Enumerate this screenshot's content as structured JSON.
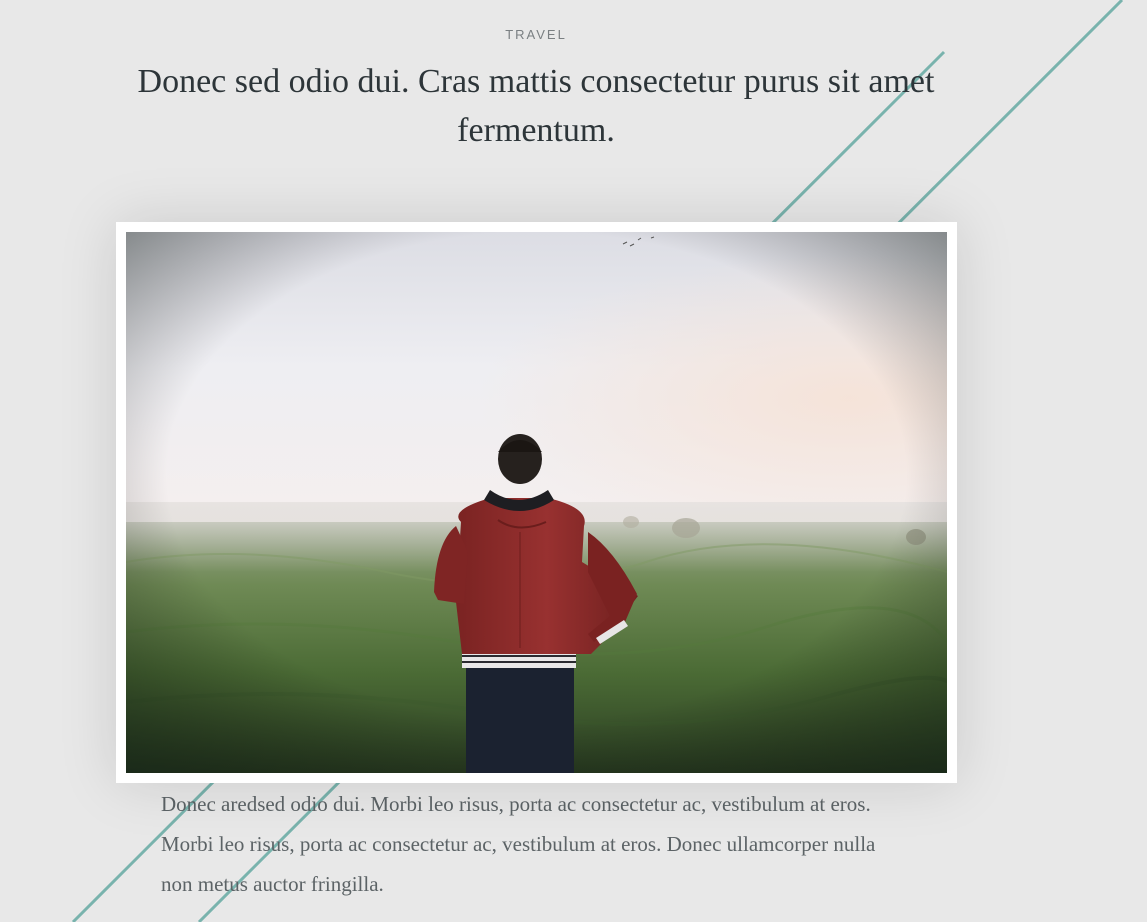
{
  "article": {
    "category": "TRAVEL",
    "title": "Donec sed odio dui. Cras mattis consectetur purus sit amet fermentum.",
    "body": "Donec aredsed odio dui. Morbi leo risus, porta ac consectetur ac, vestibulum at eros. Morbi leo risus, porta ac consectetur ac, vestibulum at eros. Donec ullamcorper nulla non metus auctor fringilla."
  },
  "image": {
    "subject": "man in red hooded jacket standing in a misty grass field facing away"
  },
  "colors": {
    "background": "#e8e8e8",
    "accent_line": "#79b3ad",
    "title": "#2d3539",
    "category": "#7a7f82",
    "body_text": "#5c6366",
    "jacket": "#8b2a28"
  }
}
